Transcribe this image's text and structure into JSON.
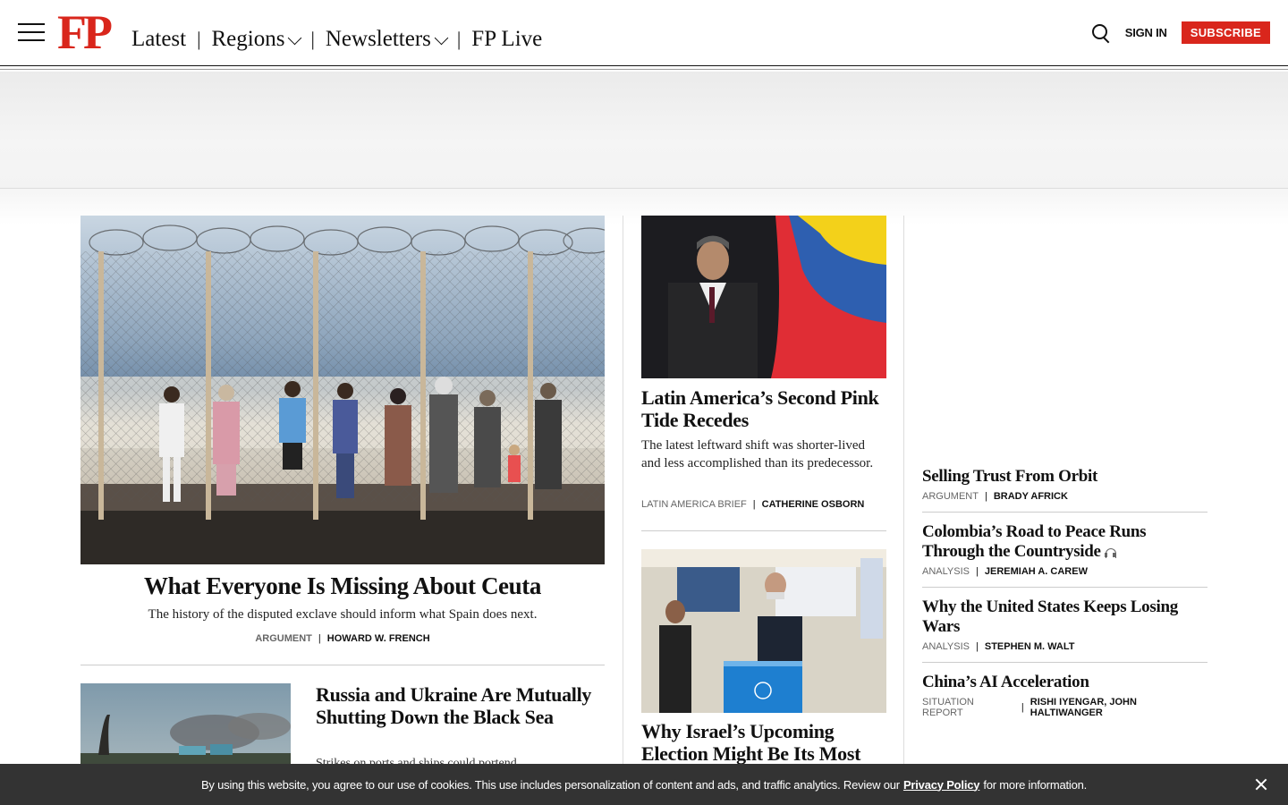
{
  "header": {
    "logo": "FP",
    "nav": [
      {
        "label": "Latest",
        "dropdown": false
      },
      {
        "label": "Regions",
        "dropdown": true
      },
      {
        "label": "Newsletters",
        "dropdown": true
      },
      {
        "label": "FP Live",
        "dropdown": false
      }
    ],
    "signin": "SIGN IN",
    "subscribe": "SUBSCRIBE"
  },
  "lead": {
    "title": "What Everyone Is Missing About Ceuta",
    "dek": "The history of the disputed exclave should inform what Spain does next.",
    "kicker": "ARGUMENT",
    "author": "HOWARD W. FRENCH"
  },
  "story2": {
    "title": "Russia and Ukraine Are Mutually Shutting Down the Black Sea",
    "dek": "Strikes on ports and ships could portend"
  },
  "middle": [
    {
      "title": "Latin America’s Second Pink Tide Recedes",
      "dek": "The latest leftward shift was shorter-lived and less accomplished than its predecessor.",
      "kicker": "LATIN AMERICA BRIEF",
      "author": "CATHERINE OSBORN"
    },
    {
      "title": "Why Israel’s Upcoming Election Might Be Its Most"
    }
  ],
  "right": [
    {
      "title": "Selling Trust From Orbit",
      "kicker": "ARGUMENT",
      "author": "BRADY AFRICK"
    },
    {
      "title": "Colombia’s Road to Peace Runs Through the Countryside",
      "kicker": "ANALYSIS",
      "author": "JEREMIAH A. CAREW",
      "audio": true
    },
    {
      "title": "Why the United States Keeps Losing Wars",
      "kicker": "ANALYSIS",
      "author": "STEPHEN M. WALT"
    },
    {
      "title": "China’s AI Acceleration",
      "kicker": "SITUATION REPORT",
      "author": "RISHI IYENGAR, JOHN HALTIWANGER"
    }
  ],
  "cookie": {
    "text_before": "By using this website, you agree to our use of cookies. This use includes personalization of content and ads, and traffic analytics. Review our",
    "link": "Privacy Policy",
    "text_after": "for more information."
  },
  "colors": {
    "brand_red": "#d9261c",
    "cookie_bg": "#333333"
  }
}
